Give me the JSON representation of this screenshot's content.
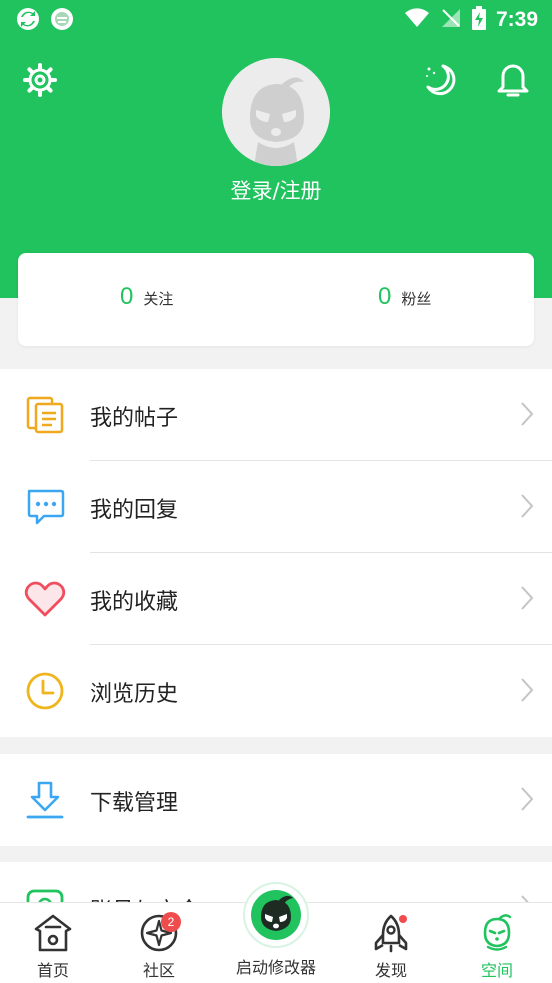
{
  "status_bar": {
    "time": "7:39",
    "icons": [
      "sync-app-icon",
      "face-app-icon",
      "wifi-icon",
      "no-signal-icon",
      "battery-charging-icon"
    ]
  },
  "header": {
    "settings_icon": "gear-icon",
    "night_mode_icon": "moon-icon",
    "notification_icon": "bell-icon",
    "avatar_icon": "default-avatar",
    "login_text": "登录/注册"
  },
  "stats": {
    "following": {
      "count": "0",
      "label": "关注"
    },
    "followers": {
      "count": "0",
      "label": "粉丝"
    }
  },
  "menu": {
    "group1": [
      {
        "label": "我的帖子",
        "icon": "document-icon"
      },
      {
        "label": "我的回复",
        "icon": "chat-bubble-icon"
      },
      {
        "label": "我的收藏",
        "icon": "heart-icon"
      },
      {
        "label": "浏览历史",
        "icon": "clock-icon"
      }
    ],
    "group2": [
      {
        "label": "下载管理",
        "icon": "download-icon"
      }
    ],
    "group3": [
      {
        "label": "账号与安全",
        "icon": "account-icon"
      }
    ]
  },
  "bottom_nav": {
    "items": [
      {
        "label": "首页",
        "icon": "home-icon",
        "active": false
      },
      {
        "label": "社区",
        "icon": "community-icon",
        "badge": "2",
        "active": false
      },
      {
        "label": "启动修改器",
        "icon": "launcher-icon",
        "active": false
      },
      {
        "label": "发现",
        "icon": "rocket-icon",
        "dot": true,
        "active": false
      },
      {
        "label": "空间",
        "icon": "space-icon",
        "active": true
      }
    ]
  },
  "colors": {
    "brand_green": "#20c35e",
    "badge_red": "#ef4d4d",
    "post_icon": "#f0a81c",
    "reply_icon": "#3ba7f2",
    "heart_icon": "#f04e5e",
    "history_icon": "#f0b41c",
    "download_icon": "#3ba7f2"
  }
}
